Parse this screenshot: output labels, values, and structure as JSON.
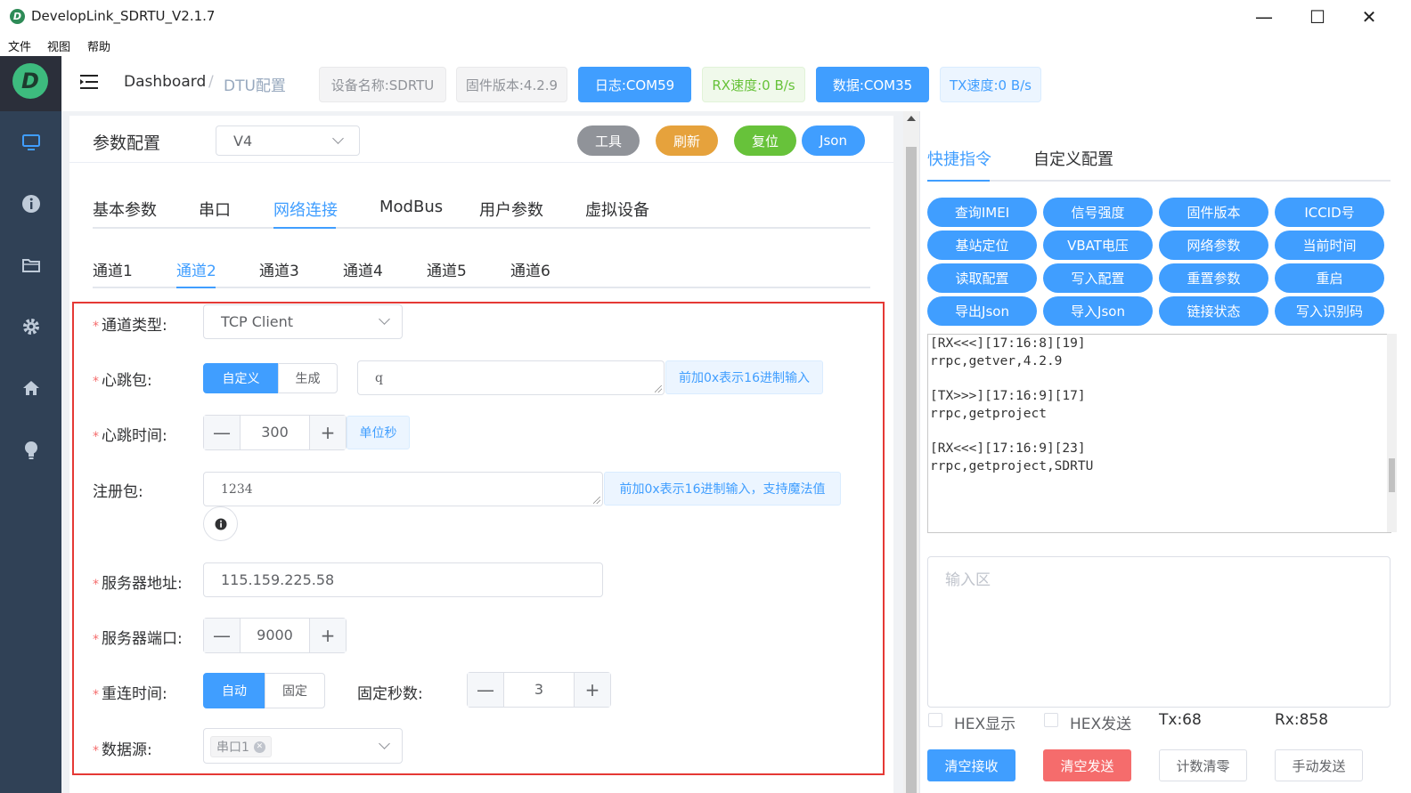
{
  "window": {
    "title": "DevelopLink_SDRTU_V2.1.7",
    "app_icon_letter": "D",
    "controls": {
      "minimize": "—",
      "maximize": "☐",
      "close": "✕"
    }
  },
  "menu": [
    "文件",
    "视图",
    "帮助"
  ],
  "sidebar": {
    "logo_letter": "D",
    "icons": [
      "monitor-icon",
      "info-icon",
      "folder-icon",
      "gear-icon",
      "home-icon",
      "bulb-icon"
    ]
  },
  "header": {
    "breadcrumb": [
      "Dashboard",
      "/",
      "DTU配置"
    ],
    "pills": [
      {
        "label": "设备名称:SDRTU",
        "bg": "#f4f4f5",
        "color": "#909399",
        "border": "#e9e9eb"
      },
      {
        "label": "固件版本:4.2.9",
        "bg": "#f4f4f5",
        "color": "#909399",
        "border": "#e9e9eb"
      },
      {
        "label": "日志:COM59",
        "bg": "#409eff",
        "color": "#ffffff",
        "border": "#409eff"
      },
      {
        "label": "RX速度:0 B/s",
        "bg": "#f0f9eb",
        "color": "#67c23a",
        "border": "#e1f3d8"
      },
      {
        "label": "数据:COM35",
        "bg": "#409eff",
        "color": "#ffffff",
        "border": "#409eff"
      },
      {
        "label": "TX速度:0 B/s",
        "bg": "#ecf5ff",
        "color": "#409eff",
        "border": "#d9ecff"
      }
    ]
  },
  "config": {
    "title": "参数配置",
    "version_select": "V4",
    "actions": [
      {
        "label": "工具",
        "color": "#909399"
      },
      {
        "label": "刷新",
        "color": "#e6a23c"
      },
      {
        "label": "复位",
        "color": "#67c23a"
      },
      {
        "label": "Json",
        "color": "#409eff"
      }
    ],
    "tabs": [
      "基本参数",
      "串口",
      "网络连接",
      "ModBus",
      "用户参数",
      "虚拟设备"
    ],
    "active_tab": 2,
    "channels": [
      "通道1",
      "通道2",
      "通道3",
      "通道4",
      "通道5",
      "通道6"
    ],
    "active_channel": 1
  },
  "form": {
    "channel_type": {
      "label": "通道类型:",
      "value": "TCP Client"
    },
    "heartbeat": {
      "label": "心跳包:",
      "options": [
        "自定义",
        "生成"
      ],
      "selected": 0,
      "value": "q",
      "hint": "前加0x表示16进制输入"
    },
    "heartbeat_time": {
      "label": "心跳时间:",
      "value": "300",
      "unit": "单位秒"
    },
    "register": {
      "label": "注册包:",
      "value": "1234",
      "hint": "前加0x表示16进制输入，支持魔法值"
    },
    "server_addr": {
      "label": "服务器地址:",
      "value": "115.159.225.58"
    },
    "server_port": {
      "label": "服务器端口:",
      "value": "9000"
    },
    "reconnect": {
      "label": "重连时间:",
      "options": [
        "自动",
        "固定"
      ],
      "selected": 0,
      "fixed_label": "固定秒数:",
      "fixed_value": "3"
    },
    "data_source": {
      "label": "数据源:",
      "tag": "串口1"
    },
    "stepper": {
      "minus": "—",
      "plus": "+"
    }
  },
  "right": {
    "tabs": [
      "快捷指令",
      "自定义配置"
    ],
    "active_tab": 0,
    "commands": [
      "查询IMEI",
      "信号强度",
      "固件版本",
      "ICCID号",
      "基站定位",
      "VBAT电压",
      "网络参数",
      "当前时间",
      "读取配置",
      "写入配置",
      "重置参数",
      "重启",
      "导出Json",
      "导入Json",
      "链接状态",
      "写入识别码"
    ],
    "log": [
      "[RX<<<][17:16:8][19]",
      "rrpc,getver,4.2.9",
      "",
      "[TX>>>][17:16:9][17]",
      "rrpc,getproject",
      "",
      "[RX<<<][17:16:9][23]",
      "rrpc,getproject,SDRTU"
    ],
    "input_placeholder": "输入区",
    "hex_show": "HEX显示",
    "hex_send": "HEX发送",
    "tx": "Tx:68",
    "rx": "Rx:858",
    "buttons": [
      {
        "label": "清空接收",
        "bg": "#409eff",
        "color": "#ffffff",
        "border": "#409eff"
      },
      {
        "label": "清空发送",
        "bg": "#f56c6c",
        "color": "#ffffff",
        "border": "#f56c6c"
      },
      {
        "label": "计数清零",
        "bg": "#ffffff",
        "color": "#606266",
        "border": "#dcdfe6"
      },
      {
        "label": "手动发送",
        "bg": "#ffffff",
        "color": "#606266",
        "border": "#dcdfe6"
      }
    ]
  }
}
